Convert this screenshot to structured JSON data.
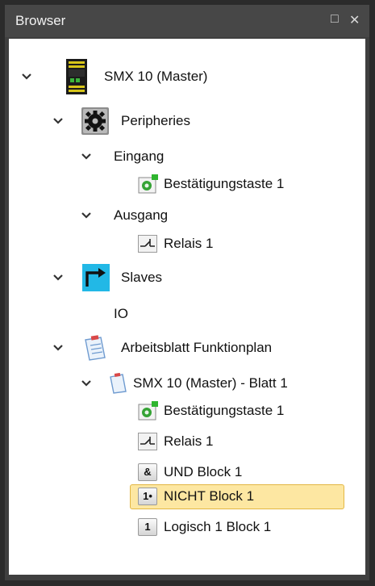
{
  "panel": {
    "title": "Browser"
  },
  "tree": {
    "master": "SMX 10 (Master)",
    "peripheries": "Peripheries",
    "eingang": "Eingang",
    "eingang_child": "Bestätigungstaste 1",
    "ausgang": "Ausgang",
    "ausgang_child": "Relais 1",
    "slaves": "Slaves",
    "io": "IO",
    "worksheet": "Arbeitsblatt Funktionplan",
    "sheet": "SMX 10 (Master) - Blatt 1",
    "sheet_items": [
      "Bestätigungstaste 1",
      "Relais 1",
      "UND Block 1",
      "NICHT Block 1",
      "Logisch 1 Block 1"
    ],
    "badges": {
      "und": "&",
      "nicht": "1•",
      "logisch": "1"
    },
    "selected_item": "NICHT Block 1"
  },
  "colors": {
    "selection_fill": "#fde7a2",
    "selection_border": "#e3b744",
    "slaves_icon_bg": "#22b8e6",
    "periph_led": "#2fb52f"
  }
}
